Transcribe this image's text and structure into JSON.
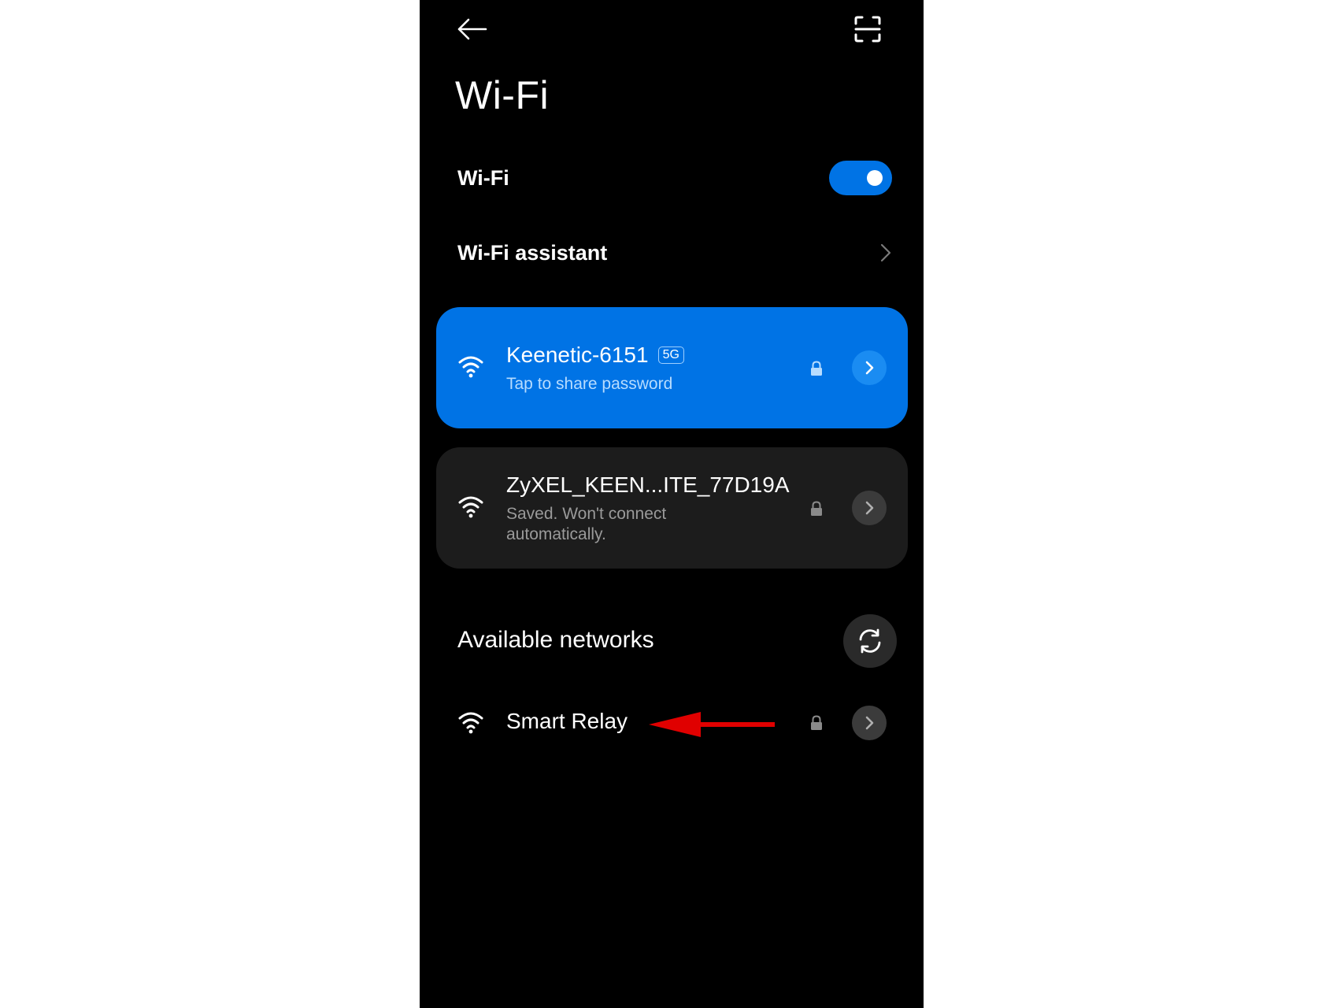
{
  "header": {
    "back_icon": "arrow-left-icon",
    "scan_icon": "scan-icon",
    "title": "Wi-Fi"
  },
  "wifi_toggle": {
    "label": "Wi-Fi",
    "enabled": true
  },
  "assistant": {
    "label": "Wi-Fi assistant",
    "chevron_icon": "chevron-right-icon"
  },
  "connected_network": {
    "name": "Keenetic-6151",
    "badge": "5G",
    "subtitle": "Tap to share password",
    "locked": true
  },
  "saved_network": {
    "name": "ZyXEL_KEEN...ITE_77D19A",
    "subtitle": "Saved. Won't connect automatically.",
    "locked": true
  },
  "available": {
    "title": "Available networks",
    "refresh_icon": "refresh-icon",
    "networks": [
      {
        "name": "Smart Relay",
        "locked": true
      }
    ]
  },
  "annotation": {
    "arrow_color": "#e00000",
    "points_to": "Smart Relay"
  },
  "colors": {
    "accent": "#0073e5",
    "background": "#000000",
    "card_dark": "#1c1c1c"
  }
}
